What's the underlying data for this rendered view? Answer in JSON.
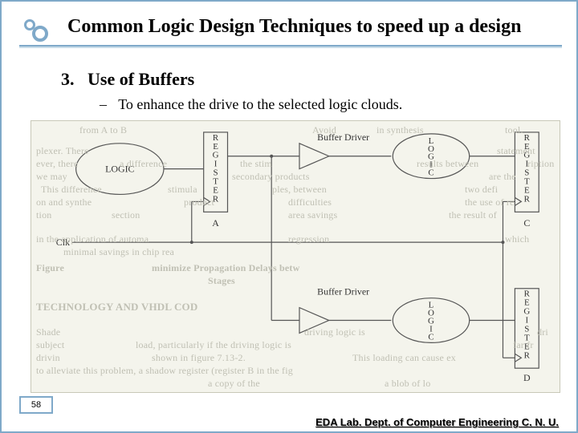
{
  "title": "Common Logic Design Techniques to speed up a design",
  "section_number": "3.",
  "section_title": "Use of Buffers",
  "sub_bullet_dash": "–",
  "sub_bullet_text": "To enhance the drive to the selected logic clouds.",
  "slide_number": "58",
  "footer": "EDA Lab. Dept. of Computer Engineering C. N. U.",
  "diagram": {
    "logic_cloud_left": "LOGIC",
    "logic_cloud_top": "LOGIC",
    "logic_cloud_bottom": "LOGIC",
    "buffer_label_top": "Buffer Driver",
    "buffer_label_bottom": "Buffer Driver",
    "register_a_label": "REGISTER",
    "register_a_id": "A",
    "register_c_label": "REGISTER",
    "register_c_id": "C",
    "register_d_label": "REGISTER",
    "register_d_id": "D",
    "clk_label": "Clk"
  },
  "ghost_lines": {
    "g0": "from A to B",
    "g1": "Avoid",
    "g2": "in synthesis",
    "g3": "tool.",
    "g4": "plexer. There",
    "g5": "statement",
    "g6": "ever, there",
    "g7": "a difference",
    "g8": "the stim",
    "g9": "results between",
    "g10": "ription",
    "g11": "we may",
    "g12": "secondary products",
    "g13": "are the",
    "g14": "This difference",
    "g15": "stimula",
    "g16": "ples, between",
    "g17": "two defi",
    "g18": "on and synthe",
    "g19": "product",
    "g20": "difficulties",
    "g21": "the use of re",
    "g22": "tion",
    "g23": "section",
    "g24": "area savings",
    "g25": "the result of",
    "g26": "in the application of automa",
    "g27": "regression",
    "g28": "which",
    "g29": "minimal savings in chip rea",
    "g30": "Figure",
    "g31": "minimize Propagation Delays betw",
    "g32": "Stages",
    "g33": "TECHNOLOGY AND VHDL COD",
    "g34": "Shade",
    "g35": "subject",
    "g36": "driving logic is",
    "g37": "dri",
    "g38": "load, particularly if the driving logic is",
    "g39": "far fr",
    "g40": "drivin",
    "g41": "shown in figure 7.13-2.",
    "g42": "This loading can cause ex",
    "g43": "to alleviate this problem, a shadow register (register B in the fig",
    "g44": "a blob of lo",
    "g45": "a copy of the"
  }
}
